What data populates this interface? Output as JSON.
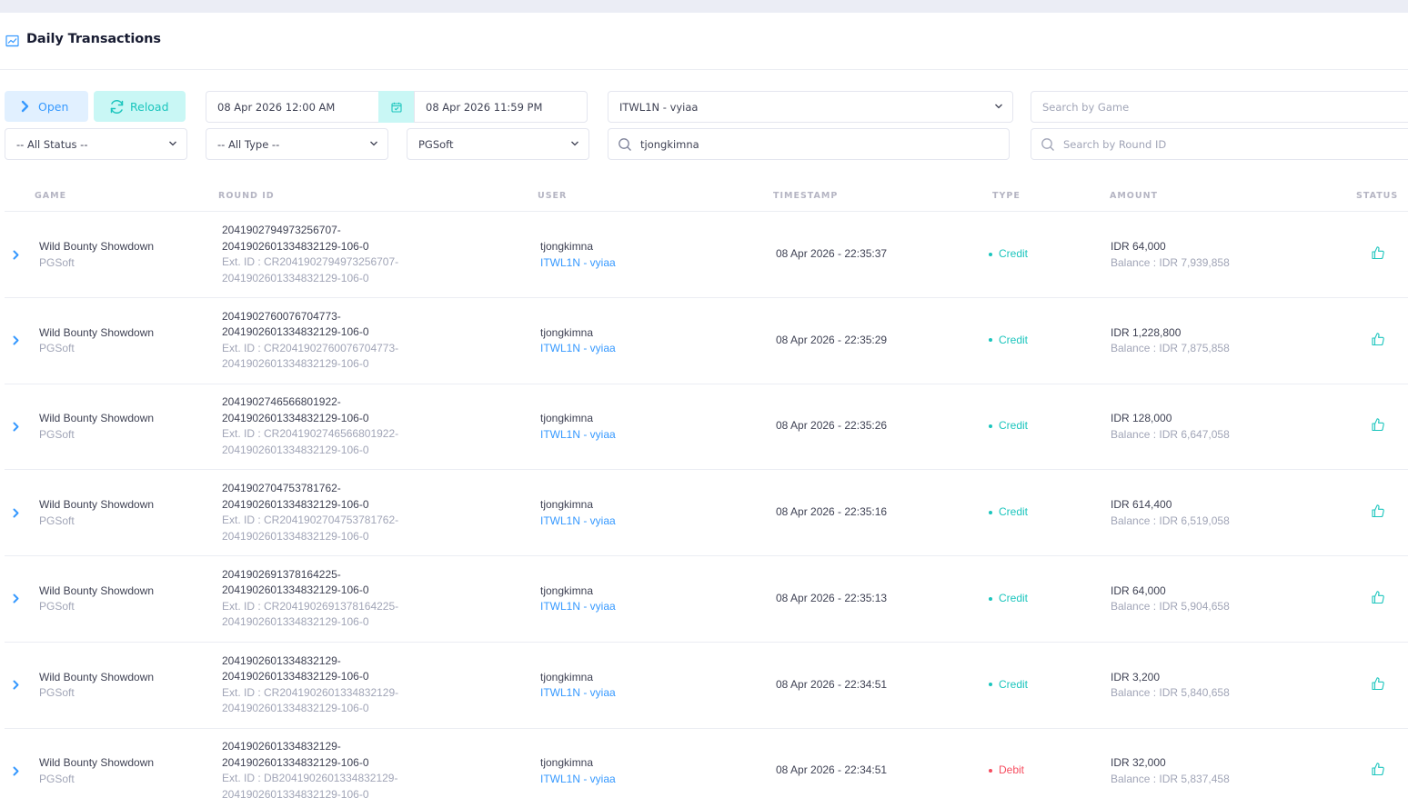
{
  "header": {
    "title": "Daily Transactions",
    "icon": "chart-line-icon"
  },
  "filters": {
    "open_label": "Open",
    "reload_label": "Reload",
    "date_from": "08 Apr 2026 12:00 AM",
    "date_to": "08 Apr 2026 11:59 PM",
    "agent": "ITWL1N - vyiaa",
    "game_search_placeholder": "Search by Game",
    "status": "-- All Status --",
    "type": "-- All Type --",
    "provider": "PGSoft",
    "user_search_value": "tjongkimna",
    "round_search_placeholder": "Search by Round ID"
  },
  "table": {
    "columns": [
      "GAME",
      "ROUND ID",
      "USER",
      "TIMESTAMP",
      "TYPE",
      "AMOUNT",
      "STATUS"
    ],
    "rows": [
      {
        "game": "Wild Bounty Showdown",
        "provider": "PGSoft",
        "round_1": "2041902794973256707-",
        "round_2": "2041902601334832129-106-0",
        "ext_1": "Ext. ID : CR2041902794973256707-",
        "ext_2": "2041902601334832129-106-0",
        "user": "tjongkimna",
        "agent": "ITWL1N - vyiaa",
        "timestamp": "08 Apr 2026 - 22:35:37",
        "type": "Credit",
        "amount": "IDR 64,000",
        "balance": "Balance : IDR 7,939,858"
      },
      {
        "game": "Wild Bounty Showdown",
        "provider": "PGSoft",
        "round_1": "2041902760076704773-",
        "round_2": "2041902601334832129-106-0",
        "ext_1": "Ext. ID : CR2041902760076704773-",
        "ext_2": "2041902601334832129-106-0",
        "user": "tjongkimna",
        "agent": "ITWL1N - vyiaa",
        "timestamp": "08 Apr 2026 - 22:35:29",
        "type": "Credit",
        "amount": "IDR 1,228,800",
        "balance": "Balance : IDR 7,875,858"
      },
      {
        "game": "Wild Bounty Showdown",
        "provider": "PGSoft",
        "round_1": "2041902746566801922-",
        "round_2": "2041902601334832129-106-0",
        "ext_1": "Ext. ID : CR2041902746566801922-",
        "ext_2": "2041902601334832129-106-0",
        "user": "tjongkimna",
        "agent": "ITWL1N - vyiaa",
        "timestamp": "08 Apr 2026 - 22:35:26",
        "type": "Credit",
        "amount": "IDR 128,000",
        "balance": "Balance : IDR 6,647,058"
      },
      {
        "game": "Wild Bounty Showdown",
        "provider": "PGSoft",
        "round_1": "2041902704753781762-",
        "round_2": "2041902601334832129-106-0",
        "ext_1": "Ext. ID : CR2041902704753781762-",
        "ext_2": "2041902601334832129-106-0",
        "user": "tjongkimna",
        "agent": "ITWL1N - vyiaa",
        "timestamp": "08 Apr 2026 - 22:35:16",
        "type": "Credit",
        "amount": "IDR 614,400",
        "balance": "Balance : IDR 6,519,058"
      },
      {
        "game": "Wild Bounty Showdown",
        "provider": "PGSoft",
        "round_1": "2041902691378164225-",
        "round_2": "2041902601334832129-106-0",
        "ext_1": "Ext. ID : CR2041902691378164225-",
        "ext_2": "2041902601334832129-106-0",
        "user": "tjongkimna",
        "agent": "ITWL1N - vyiaa",
        "timestamp": "08 Apr 2026 - 22:35:13",
        "type": "Credit",
        "amount": "IDR 64,000",
        "balance": "Balance : IDR 5,904,658"
      },
      {
        "game": "Wild Bounty Showdown",
        "provider": "PGSoft",
        "round_1": "2041902601334832129-",
        "round_2": "2041902601334832129-106-0",
        "ext_1": "Ext. ID : CR2041902601334832129-",
        "ext_2": "2041902601334832129-106-0",
        "user": "tjongkimna",
        "agent": "ITWL1N - vyiaa",
        "timestamp": "08 Apr 2026 - 22:34:51",
        "type": "Credit",
        "amount": "IDR 3,200",
        "balance": "Balance : IDR 5,840,658"
      },
      {
        "game": "Wild Bounty Showdown",
        "provider": "PGSoft",
        "round_1": "2041902601334832129-",
        "round_2": "2041902601334832129-106-0",
        "ext_1": "Ext. ID : DB2041902601334832129-",
        "ext_2": "2041902601334832129-106-0",
        "user": "tjongkimna",
        "agent": "ITWL1N - vyiaa",
        "timestamp": "08 Apr 2026 - 22:34:51",
        "type": "Debit",
        "amount": "IDR 32,000",
        "balance": "Balance : IDR 5,837,458"
      }
    ]
  },
  "colors": {
    "primary": "#3699ff",
    "success": "#1bc5bd",
    "danger": "#f64e60",
    "muted": "#a1a5b7"
  }
}
